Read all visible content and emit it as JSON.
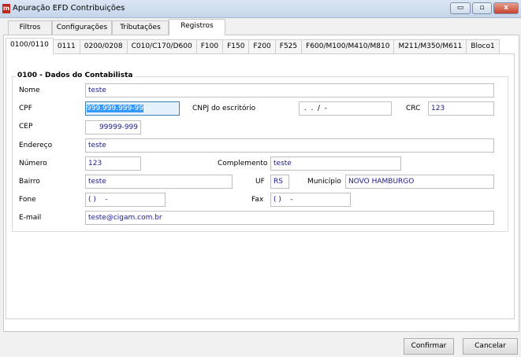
{
  "window": {
    "title": "Apuração EFD Contribuições",
    "minimize": "▭",
    "maximize": "▫",
    "close": "x"
  },
  "outer_tabs": [
    {
      "label": "Filtros"
    },
    {
      "label": "Configurações"
    },
    {
      "label": "Tributações"
    },
    {
      "label": "Registros",
      "selected": true
    }
  ],
  "inner_tabs": [
    {
      "label": "0100/0110",
      "selected": true
    },
    {
      "label": "0111"
    },
    {
      "label": "0200/0208"
    },
    {
      "label": "C010/C170/D600"
    },
    {
      "label": "F100"
    },
    {
      "label": "F150"
    },
    {
      "label": "F200"
    },
    {
      "label": "F525"
    },
    {
      "label": "F600/M100/M410/M810"
    },
    {
      "label": "M211/M350/M611"
    },
    {
      "label": "Bloco1"
    }
  ],
  "group": {
    "title": "0100 - Dados do Contabilista"
  },
  "form": {
    "nome": {
      "label": "Nome",
      "value": "teste"
    },
    "cpf": {
      "label": "CPF",
      "value": "999.999.999-99"
    },
    "cnpj": {
      "label": "CNPJ do escritório",
      "value": " .  .  /  -"
    },
    "crc": {
      "label": "CRC",
      "value": "123"
    },
    "cep": {
      "label": "CEP",
      "value": "99999-999"
    },
    "endereco": {
      "label": "Endereço",
      "value": "teste"
    },
    "numero": {
      "label": "Número",
      "value": "123"
    },
    "complemento": {
      "label": "Complemento",
      "value": "teste"
    },
    "bairro": {
      "label": "Bairro",
      "value": "teste"
    },
    "uf": {
      "label": "UF",
      "value": "RS"
    },
    "municipio": {
      "label": "Município",
      "value": "NOVO HAMBURGO"
    },
    "fone": {
      "label": "Fone",
      "value": "( )    -"
    },
    "fax": {
      "label": "Fax",
      "value": "( )    -"
    },
    "email": {
      "label": "E-mail",
      "value": "teste@cigam.com.br"
    }
  },
  "buttons": {
    "confirm": "Confirmar",
    "cancel": "Cancelar"
  }
}
